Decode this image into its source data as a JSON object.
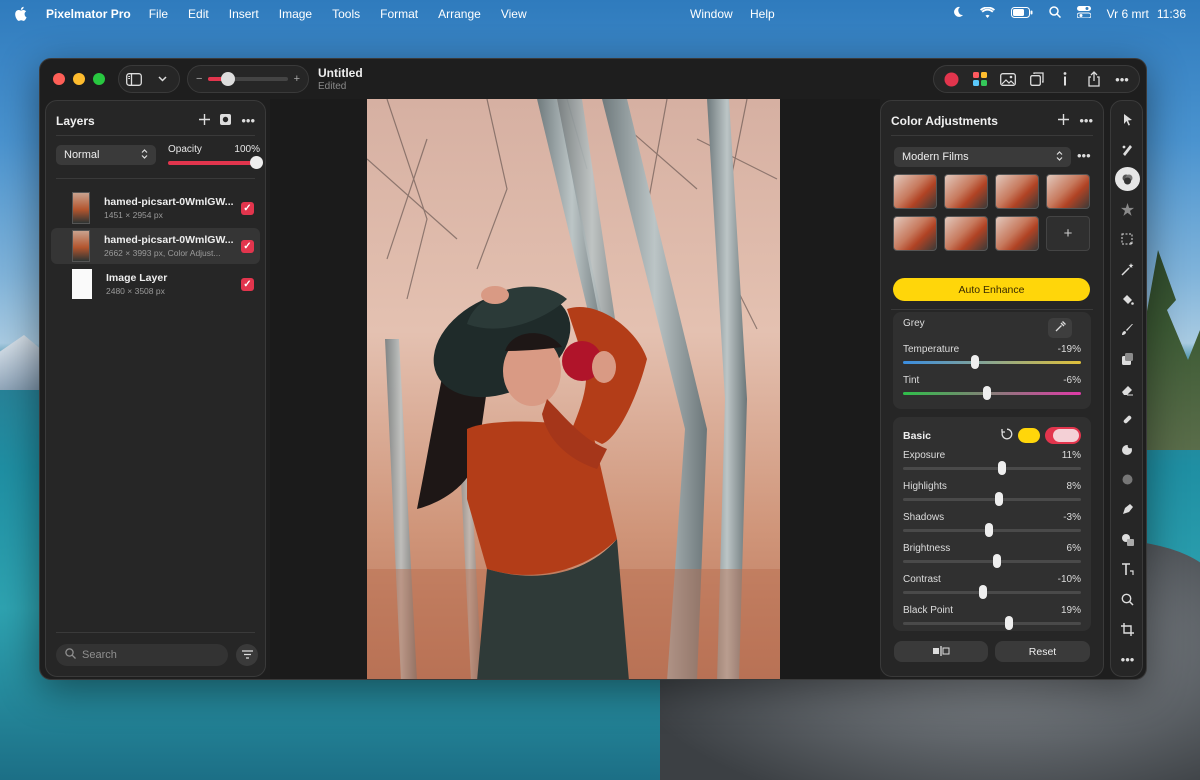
{
  "menubar": {
    "app_name": "Pixelmator Pro",
    "menus": [
      "File",
      "Edit",
      "Insert",
      "Image",
      "Tools",
      "Format",
      "Arrange",
      "View"
    ],
    "window": "Window",
    "help": "Help",
    "date": "Vr 6 mrt",
    "time": "11:36"
  },
  "document": {
    "title": "Untitled",
    "subtitle": "Edited",
    "zoom_level": 0.25
  },
  "layers_panel": {
    "title": "Layers",
    "blend_mode": "Normal",
    "opacity_label": "Opacity",
    "opacity_value": "100%",
    "layers": [
      {
        "name": "hamed-picsart-0WmlGW...",
        "meta": "1451 × 2954 px",
        "selected": false,
        "visible": true
      },
      {
        "name": "hamed-picsart-0WmlGW...",
        "meta": "2662 × 3993 px, Color Adjust...",
        "selected": true,
        "visible": true
      },
      {
        "name": "Image Layer",
        "meta": "2480 × 3508 px",
        "selected": false,
        "visible": true
      }
    ],
    "search_placeholder": "Search"
  },
  "adjust_panel": {
    "title": "Color Adjustments",
    "preset": "Modern Films",
    "auto_enhance": "Auto Enhance",
    "grey_label": "Grey",
    "temperature": {
      "label": "Temperature",
      "value": "-19%",
      "level": -0.19
    },
    "tint": {
      "label": "Tint",
      "value": "-6%",
      "level": -0.06
    },
    "basic_label": "Basic",
    "basic": [
      {
        "label": "Exposure",
        "value": "11%",
        "level": 0.11
      },
      {
        "label": "Highlights",
        "value": "8%",
        "level": 0.08
      },
      {
        "label": "Shadows",
        "value": "-3%",
        "level": -0.03
      },
      {
        "label": "Brightness",
        "value": "6%",
        "level": 0.06
      },
      {
        "label": "Contrast",
        "value": "-10%",
        "level": -0.1
      },
      {
        "label": "Black Point",
        "value": "19%",
        "level": 0.19
      }
    ],
    "reset": "Reset"
  },
  "colors": {
    "accent": "#e2354d",
    "auto_enhance": "#ffd60a",
    "panel": "#262626"
  }
}
